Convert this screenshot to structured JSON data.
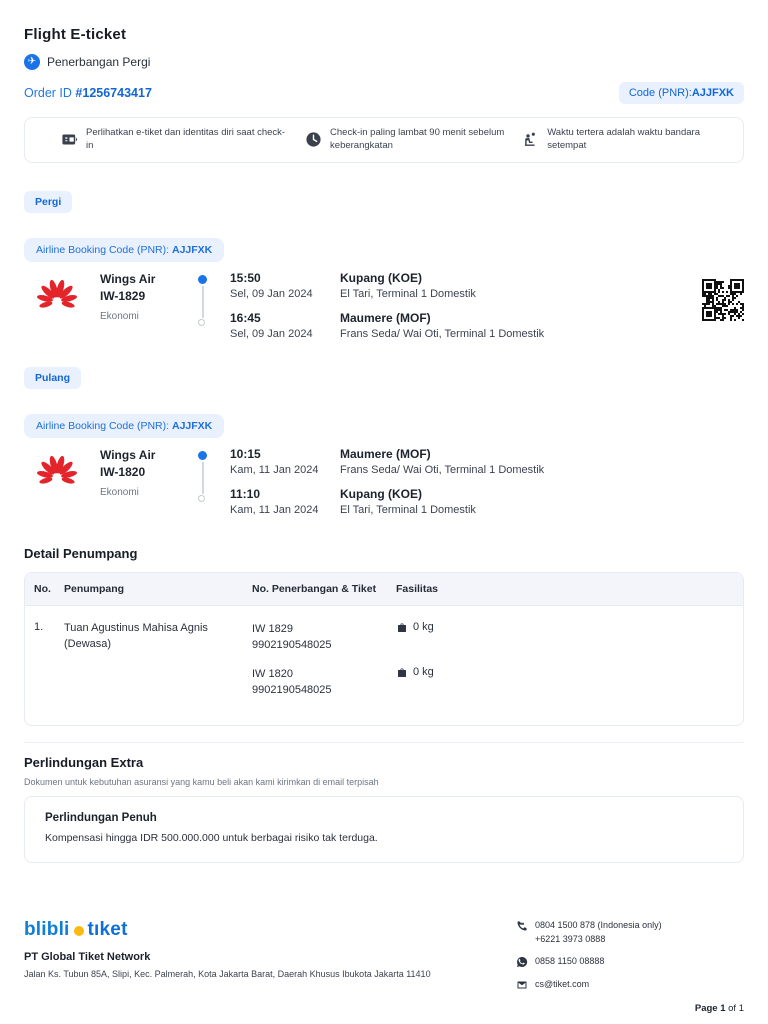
{
  "header": {
    "title": "Flight E-ticket",
    "trip_type_label": "Penerbangan Pergi",
    "order_id_label": "Order ID",
    "order_id_value": "#1256743417",
    "pnr_pill_label": "Code (PNR):",
    "pnr_pill_value": "AJJFXK"
  },
  "notices": [
    {
      "icon": "eticket-id-icon",
      "text": "Perlihatkan e-tiket dan identitas diri saat check-in"
    },
    {
      "icon": "clock-icon",
      "text": "Check-in paling lambat 90 menit sebelum keberangkatan"
    },
    {
      "icon": "airport-time-icon",
      "text": "Waktu tertera adalah waktu bandara setempat"
    }
  ],
  "segments": [
    {
      "direction_label": "Pergi",
      "booking_code_label": "Airline Booking Code (PNR):",
      "booking_code": "AJJFXK",
      "airline": "Wings Air",
      "flight_no": "IW-1829",
      "cabin_class": "Ekonomi",
      "departure": {
        "time": "15:50",
        "date": "Sel, 09 Jan 2024",
        "city": "Kupang (KOE)",
        "airport": "El Tari, Terminal 1 Domestik"
      },
      "arrival": {
        "time": "16:45",
        "date": "Sel, 09 Jan 2024",
        "city": "Maumere (MOF)",
        "airport": "Frans Seda/ Wai Oti, Terminal 1 Domestik"
      }
    },
    {
      "direction_label": "Pulang",
      "booking_code_label": "Airline Booking Code (PNR):",
      "booking_code": "AJJFXK",
      "airline": "Wings Air",
      "flight_no": "IW-1820",
      "cabin_class": "Ekonomi",
      "departure": {
        "time": "10:15",
        "date": "Kam, 11 Jan 2024",
        "city": "Maumere (MOF)",
        "airport": "Frans Seda/ Wai Oti, Terminal 1 Domestik"
      },
      "arrival": {
        "time": "11:10",
        "date": "Kam, 11 Jan 2024",
        "city": "Kupang (KOE)",
        "airport": "El Tari, Terminal 1 Domestik"
      }
    }
  ],
  "passengers": {
    "heading": "Detail Penumpang",
    "columns": [
      "No.",
      "Penumpang",
      "No. Penerbangan & Tiket",
      "Fasilitas"
    ],
    "rows": [
      {
        "no": "1.",
        "name": "Tuan Agustinus Mahisa Agnis",
        "type": "(Dewasa)",
        "tickets": [
          {
            "flight": "IW 1829",
            "ticket": "9902190548025",
            "baggage": "0 kg"
          },
          {
            "flight": "IW 1820",
            "ticket": "9902190548025",
            "baggage": "0 kg"
          }
        ]
      }
    ]
  },
  "protection": {
    "heading": "Perlindungan Extra",
    "subtext": "Dokumen untuk kebutuhan asuransi yang kamu beli akan kami kirimkan di email terpisah",
    "card_title": "Perlindungan Penuh",
    "card_desc": "Kompensasi hingga IDR 500.000.000 untuk berbagai risiko tak terduga."
  },
  "footer": {
    "brand_part1": "blibli",
    "brand_part2": "tıket",
    "company": "PT Global Tiket Network",
    "address": "Jalan Ks. Tubun 85A, Slipi, Kec. Palmerah, Kota Jakarta Barat, Daerah Khusus Ibukota Jakarta 11410",
    "contacts": [
      {
        "icon": "phone-icon",
        "lines": [
          "0804 1500 878 (Indonesia only)",
          "+6221 3973 0888"
        ]
      },
      {
        "icon": "whatsapp-icon",
        "lines": [
          "0858 1150 08888"
        ]
      },
      {
        "icon": "email-icon",
        "lines": [
          "cs@tiket.com"
        ]
      }
    ],
    "page_label": "Page 1",
    "page_suffix": " of 1"
  },
  "colors": {
    "accent": "#0064D2",
    "pill_bg": "#E8F1FD",
    "airline_red": "#E3242B",
    "brand_yellow": "#FCB813"
  }
}
